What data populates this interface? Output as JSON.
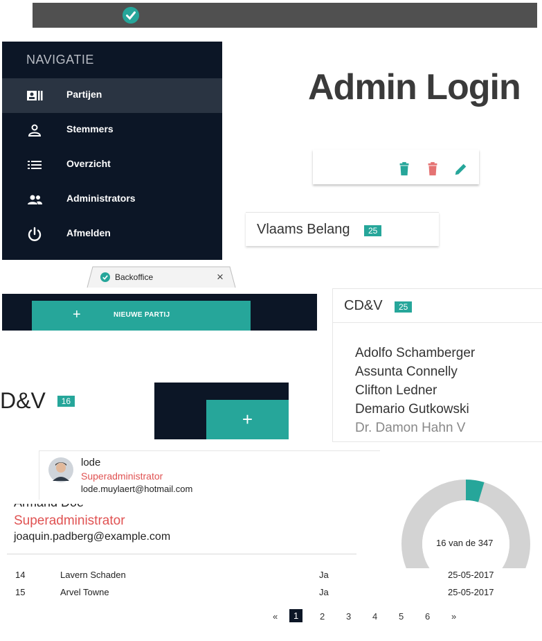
{
  "topbar": {
    "icon": "check-circle-icon"
  },
  "nav": {
    "title": "NAVIGATIE",
    "items": [
      {
        "label": "Partijen",
        "icon": "id-card-icon",
        "active": true
      },
      {
        "label": "Stemmers",
        "icon": "person-icon",
        "active": false
      },
      {
        "label": "Overzicht",
        "icon": "list-icon",
        "active": false
      },
      {
        "label": "Administrators",
        "icon": "people-icon",
        "active": false
      },
      {
        "label": "Afmelden",
        "icon": "power-icon",
        "active": false
      }
    ]
  },
  "page_title": "Admin Login",
  "actions": {
    "icons": [
      "trash-teal-icon",
      "trash-red-icon",
      "edit-icon"
    ]
  },
  "party_card": {
    "name": "Vlaams Belang",
    "count": "25"
  },
  "browser_tab": {
    "title": "Backoffice",
    "close": "×"
  },
  "new_party_button": {
    "plus": "+",
    "label": "NIEUWE PARTIJ"
  },
  "cdv_card": {
    "name": "CD&V",
    "count": "25",
    "members": [
      "Adolfo Schamberger",
      "Assunta Connelly",
      "Clifton Ledner",
      "Demario Gutkowski",
      "Dr. Damon Hahn V"
    ]
  },
  "cdv_partial": {
    "name": "D&V",
    "count": "16"
  },
  "plus_button": {
    "label": "+"
  },
  "user_card": {
    "name": "lode",
    "role": "Superadministrator",
    "email": "lode.muylaert@hotmail.com"
  },
  "user2": {
    "name_partial": "Armand Doe",
    "role": "Superadministrator",
    "email": "joaquin.padberg@example.com"
  },
  "donut": {
    "label": "16 van de 347",
    "value": 16,
    "total": 347
  },
  "table": {
    "rows": [
      {
        "id": "14",
        "name": "Lavern Schaden",
        "voted": "Ja",
        "date": "25-05-2017"
      },
      {
        "id": "15",
        "name": "Arvel Towne",
        "voted": "Ja",
        "date": "25-05-2017"
      }
    ]
  },
  "pagination": {
    "prev": "«",
    "pages": [
      "1",
      "2",
      "3",
      "4",
      "5",
      "6"
    ],
    "current": "1",
    "next": "»"
  },
  "colors": {
    "accent": "#26a69a",
    "danger": "#e57373",
    "nav_bg": "#0c1626",
    "role_red": "#e05252"
  }
}
